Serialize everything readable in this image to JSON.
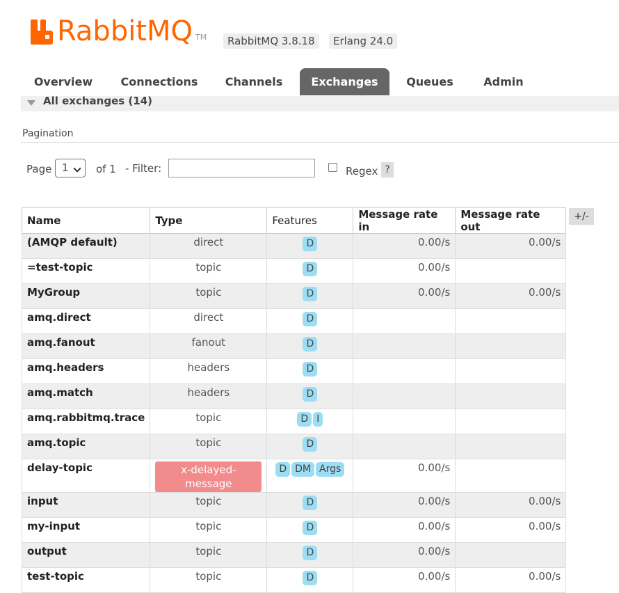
{
  "header": {
    "logo_text": "RabbitMQ",
    "logo_tm": "TM",
    "rabbitmq_version": "RabbitMQ 3.8.18",
    "erlang_version": "Erlang 24.0",
    "brand_color": "#ff6600"
  },
  "tabs": [
    "Overview",
    "Connections",
    "Channels",
    "Exchanges",
    "Queues",
    "Admin"
  ],
  "active_tab": "Exchanges",
  "section": {
    "title": "All exchanges (14)"
  },
  "pagination": {
    "label": "Pagination",
    "page_label": "Page",
    "page_value": "1",
    "of_label": "of 1",
    "filter_label": "- Filter:",
    "filter_value": "",
    "regex_label": "Regex",
    "regex_checked": false,
    "help": "?"
  },
  "table": {
    "headers": [
      "Name",
      "Type",
      "Features",
      "Message rate in",
      "Message rate out"
    ],
    "plus_minus": "+/-",
    "rows": [
      {
        "name": "(AMQP default)",
        "type": "direct",
        "features": [
          "D"
        ],
        "rate_in": "0.00/s",
        "rate_out": "0.00/s"
      },
      {
        "name": "=test-topic",
        "type": "topic",
        "features": [
          "D"
        ],
        "rate_in": "0.00/s",
        "rate_out": ""
      },
      {
        "name": "MyGroup",
        "type": "topic",
        "features": [
          "D"
        ],
        "rate_in": "0.00/s",
        "rate_out": "0.00/s"
      },
      {
        "name": "amq.direct",
        "type": "direct",
        "features": [
          "D"
        ],
        "rate_in": "",
        "rate_out": ""
      },
      {
        "name": "amq.fanout",
        "type": "fanout",
        "features": [
          "D"
        ],
        "rate_in": "",
        "rate_out": ""
      },
      {
        "name": "amq.headers",
        "type": "headers",
        "features": [
          "D"
        ],
        "rate_in": "",
        "rate_out": ""
      },
      {
        "name": "amq.match",
        "type": "headers",
        "features": [
          "D"
        ],
        "rate_in": "",
        "rate_out": ""
      },
      {
        "name": "amq.rabbitmq.trace",
        "type": "topic",
        "features": [
          "D",
          "I"
        ],
        "rate_in": "",
        "rate_out": ""
      },
      {
        "name": "amq.topic",
        "type": "topic",
        "features": [
          "D"
        ],
        "rate_in": "",
        "rate_out": ""
      },
      {
        "name": "delay-topic",
        "type": "x-delayed-message",
        "type_highlight": true,
        "features": [
          "D",
          "DM",
          "Args"
        ],
        "rate_in": "0.00/s",
        "rate_out": ""
      },
      {
        "name": "input",
        "type": "topic",
        "features": [
          "D"
        ],
        "rate_in": "0.00/s",
        "rate_out": "0.00/s"
      },
      {
        "name": "my-input",
        "type": "topic",
        "features": [
          "D"
        ],
        "rate_in": "0.00/s",
        "rate_out": "0.00/s"
      },
      {
        "name": "output",
        "type": "topic",
        "features": [
          "D"
        ],
        "rate_in": "0.00/s",
        "rate_out": ""
      },
      {
        "name": "test-topic",
        "type": "topic",
        "features": [
          "D"
        ],
        "rate_in": "0.00/s",
        "rate_out": "0.00/s"
      }
    ]
  }
}
